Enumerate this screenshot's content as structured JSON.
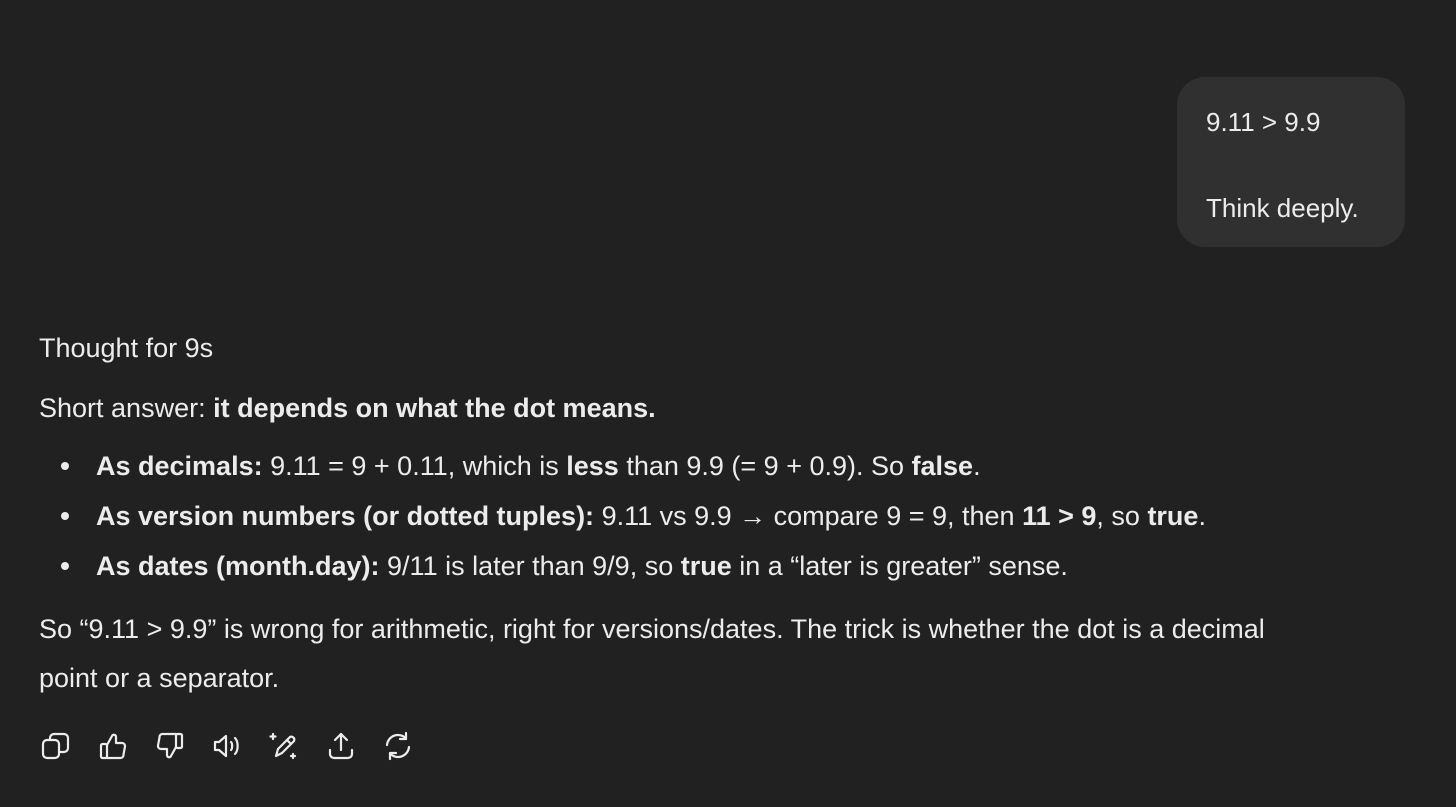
{
  "user_message": {
    "line1": "9.11 > 9.9",
    "line2": "Think deeply."
  },
  "assistant": {
    "thought_label": "Thought for 9s",
    "short_prefix": "Short answer: ",
    "short_bold": "it depends on what the dot means.",
    "bullets": [
      {
        "p1b": "As decimals:",
        "p2": " 9.11 = 9 + 0.11, which is ",
        "p3b": "less",
        "p4": " than 9.9 (= 9 + 0.9). So ",
        "p5b": "false",
        "p6": "."
      },
      {
        "p1b": "As version numbers (or dotted tuples):",
        "p2": " 9.11 vs 9.9 → compare 9 = 9, then ",
        "p3b": "11 > 9",
        "p4": ", so ",
        "p5b": "true",
        "p6": "."
      },
      {
        "p1b": "As dates (month.day):",
        "p2": " 9/11 is later than 9/9, so ",
        "p3b": "true",
        "p4": " in a “later is greater” sense.",
        "p5b": "",
        "p6": ""
      }
    ],
    "summary_line1": "So “9.11 > 9.9” is wrong for arithmetic, right for versions/dates. The trick is whether the dot is a decimal",
    "summary_line2": "point or a separator."
  },
  "actions": [
    {
      "icon": "copy-icon"
    },
    {
      "icon": "thumbs-up-icon"
    },
    {
      "icon": "thumbs-down-icon"
    },
    {
      "icon": "read-aloud-icon"
    },
    {
      "icon": "edit-canvas-icon"
    },
    {
      "icon": "share-icon"
    },
    {
      "icon": "regenerate-icon"
    }
  ],
  "colors": {
    "background": "#212121",
    "user_bubble": "#303030",
    "text": "#ececec"
  }
}
